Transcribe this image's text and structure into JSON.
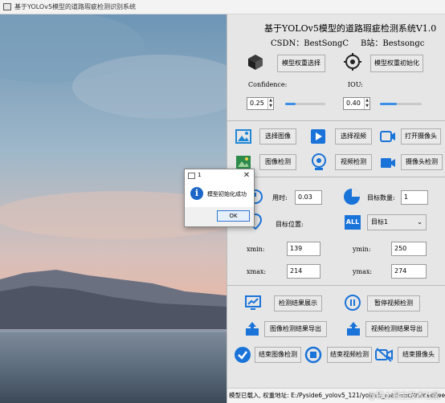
{
  "window": {
    "title": "基于YOLOv5模型的道路瑕疵检测识别系统"
  },
  "panel": {
    "heading": "基于YOLOv5模型的道路瑕疵检测系统V1.0",
    "csdn": "CSDN：BestSongC",
    "bilibili": "B站：Bestsongc",
    "buttons": {
      "select_weights": "模型权重选择",
      "init_model": "模型权重初始化",
      "select_image": "选择图像",
      "select_video": "选择视频",
      "open_camera": "打开摄像头",
      "detect_image": "图像检测",
      "detect_video": "视频检测",
      "detect_camera": "摄像头检测",
      "show_results": "检测结果展示",
      "pause_video": "暂停视频检测",
      "export_image_results": "图像检测结果导出",
      "export_video_results": "视频检测结果导出",
      "end_image_detect": "结束图像检测",
      "end_video_detect": "结束视频检测",
      "end_camera": "结束摄像头"
    },
    "confidence": {
      "label": "Confidence:",
      "value": "0.25",
      "slider_fraction": 0.25
    },
    "iou": {
      "label": "IOU:",
      "value": "0.40",
      "slider_fraction": 0.4
    },
    "elapsed": {
      "label": "用时:",
      "value": "0.03"
    },
    "target_count": {
      "label": "目标数量:",
      "value": "1"
    },
    "target_position": {
      "label": "目标位置:"
    },
    "target_select": {
      "value": "目标1"
    },
    "xmin": {
      "label": "xmin:",
      "value": "139"
    },
    "ymin": {
      "label": "ymin:",
      "value": "250"
    },
    "xmax": {
      "label": "xmax:",
      "value": "214"
    },
    "ymax": {
      "label": "ymax:",
      "value": "274"
    },
    "status": "模型已载入, 权重地址: E:/Pyside6_yolov5_121/yolov5_road-voc/trained/weights/best.pt"
  },
  "dialog": {
    "title": "1",
    "message": "模型初始化成功",
    "ok_label": "OK"
  },
  "watermark": "@稀土掘金技术社区",
  "colors": {
    "accent_blue": "#1c66c8",
    "slider_fill": "#3b8fe8",
    "panel_bg": "#e6e6e6"
  }
}
